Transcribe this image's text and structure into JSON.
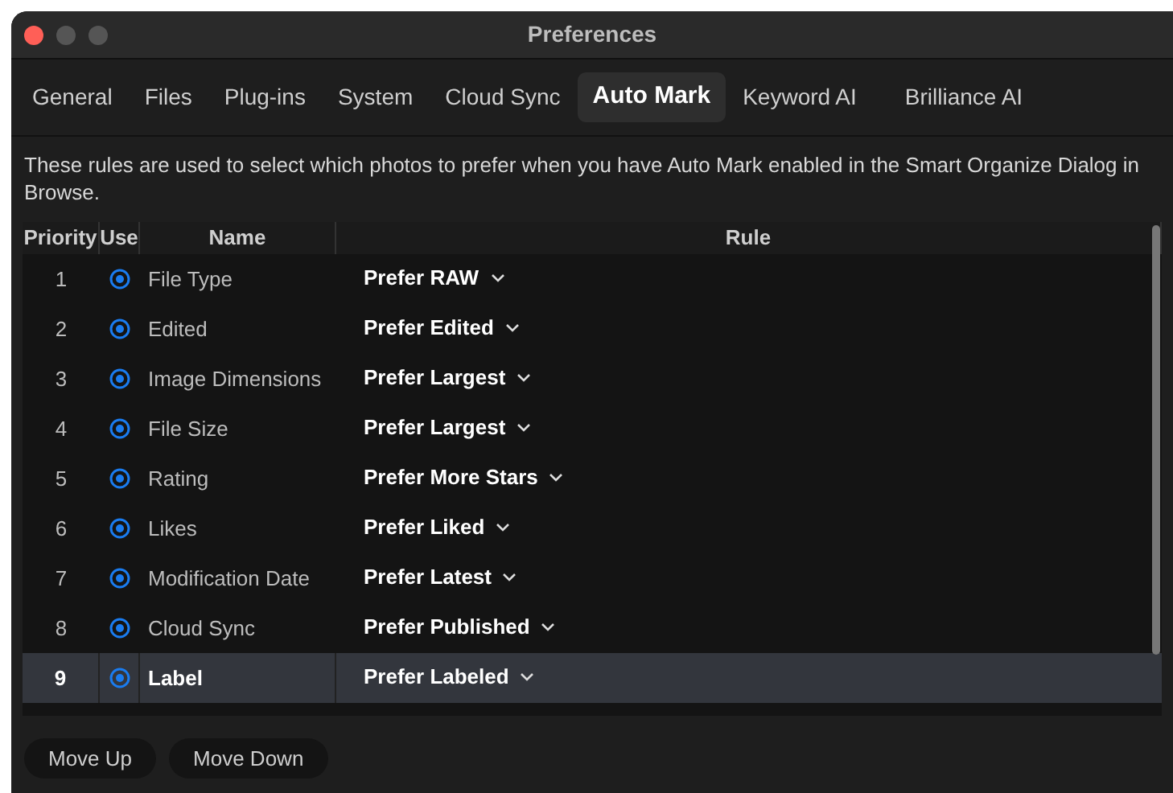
{
  "window": {
    "title": "Preferences"
  },
  "tabs": [
    {
      "label": "General",
      "selected": false
    },
    {
      "label": "Files",
      "selected": false
    },
    {
      "label": "Plug-ins",
      "selected": false
    },
    {
      "label": "System",
      "selected": false
    },
    {
      "label": "Cloud Sync",
      "selected": false
    },
    {
      "label": "Auto Mark",
      "selected": true
    },
    {
      "label": "Keyword AI",
      "selected": false
    },
    {
      "label": "Brilliance AI",
      "selected": false
    }
  ],
  "description": "These rules are used to select which photos to prefer when you have Auto Mark enabled in the Smart Organize Dialog in Browse.",
  "table": {
    "columns": [
      "Priority",
      "Use",
      "Name",
      "Rule"
    ],
    "rows": [
      {
        "priority": "1",
        "use": true,
        "name": "File Type",
        "rule": "Prefer RAW",
        "selected": false
      },
      {
        "priority": "2",
        "use": true,
        "name": "Edited",
        "rule": "Prefer Edited",
        "selected": false
      },
      {
        "priority": "3",
        "use": true,
        "name": "Image Dimensions",
        "rule": "Prefer Largest",
        "selected": false
      },
      {
        "priority": "4",
        "use": true,
        "name": "File Size",
        "rule": "Prefer Largest",
        "selected": false
      },
      {
        "priority": "5",
        "use": true,
        "name": "Rating",
        "rule": "Prefer More Stars",
        "selected": false
      },
      {
        "priority": "6",
        "use": true,
        "name": "Likes",
        "rule": "Prefer Liked",
        "selected": false
      },
      {
        "priority": "7",
        "use": true,
        "name": "Modification Date",
        "rule": "Prefer Latest",
        "selected": false
      },
      {
        "priority": "8",
        "use": true,
        "name": "Cloud Sync",
        "rule": "Prefer Published",
        "selected": false
      },
      {
        "priority": "9",
        "use": true,
        "name": "Label",
        "rule": "Prefer Labeled",
        "selected": true
      }
    ]
  },
  "buttons": [
    "Move Up",
    "Move Down"
  ]
}
